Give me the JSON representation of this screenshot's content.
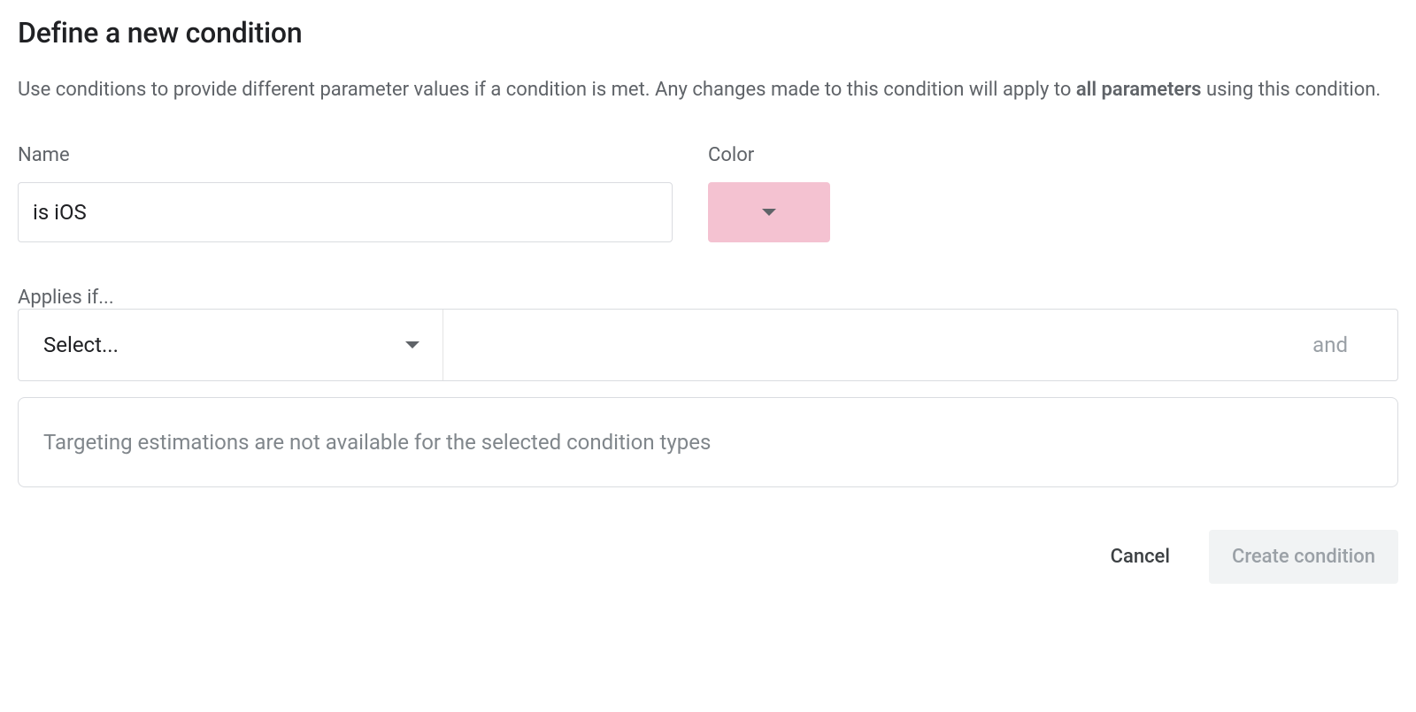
{
  "title": "Define a new condition",
  "description": {
    "prefix": "Use conditions to provide different parameter values if a condition is met. Any changes made to this condition will apply to ",
    "bold": "all parameters",
    "suffix": " using this condition."
  },
  "fields": {
    "name_label": "Name",
    "name_value": "is iOS",
    "color_label": "Color",
    "color_value": "#f4c2d1"
  },
  "applies": {
    "label": "Applies if...",
    "select_placeholder": "Select...",
    "and_label": "and"
  },
  "info": {
    "message": "Targeting estimations are not available for the selected condition types"
  },
  "buttons": {
    "cancel": "Cancel",
    "create": "Create condition"
  }
}
